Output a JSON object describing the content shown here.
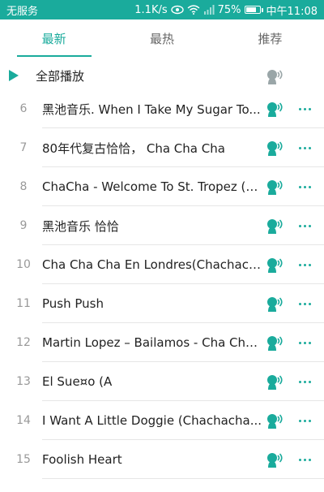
{
  "status_bar": {
    "carrier": "无服务",
    "speed": "1.1K/s",
    "battery_percent": "75%",
    "battery_level": 0.75,
    "time": "中午11:08"
  },
  "tabs": [
    {
      "label": "最新",
      "active": true
    },
    {
      "label": "最热",
      "active": false
    },
    {
      "label": "推荐",
      "active": false
    }
  ],
  "play_all": {
    "label": "全部播放"
  },
  "accent_color": "#1aab9c",
  "songs": [
    {
      "num": "6",
      "title": "黑池音乐. When I Take My Sugar To..."
    },
    {
      "num": "7",
      "title": "80年代复古恰恰， Cha Cha Cha"
    },
    {
      "num": "8",
      "title": "ChaCha - Welcome To St. Tropez (3..."
    },
    {
      "num": "9",
      "title": "黑池音乐 恰恰"
    },
    {
      "num": "10",
      "title": "Cha Cha Cha En Londres(Chachach..."
    },
    {
      "num": "11",
      "title": "Push Push"
    },
    {
      "num": "12",
      "title": "Martin Lopez – Bailamos - Cha Cha..."
    },
    {
      "num": "13",
      "title": "El Sue¤o (A"
    },
    {
      "num": "14",
      "title": "I Want A Little Doggie (Chachacha..."
    },
    {
      "num": "15",
      "title": "Foolish Heart"
    }
  ]
}
